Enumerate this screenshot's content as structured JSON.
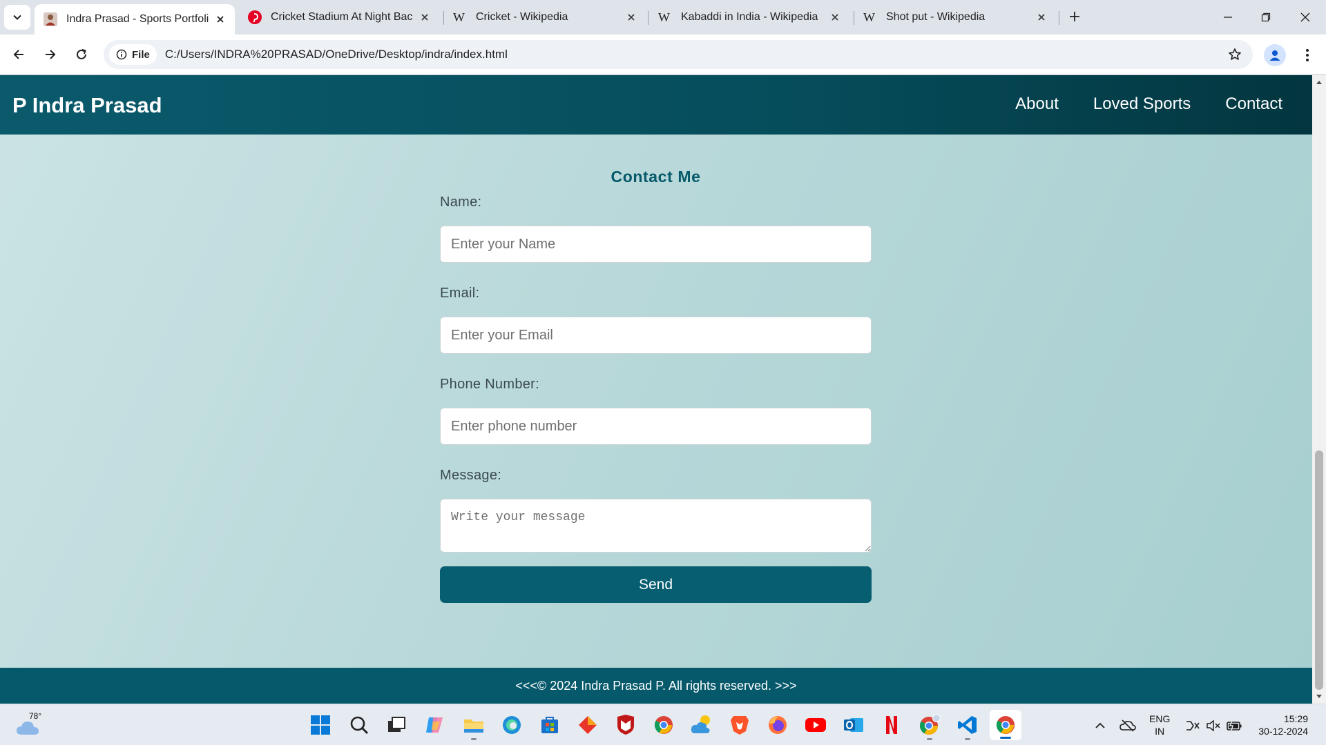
{
  "browser": {
    "tabs": [
      {
        "title": "Indra Prasad - Sports Portfolio",
        "active": true,
        "icon": "person-photo-icon"
      },
      {
        "title": "Cricket Stadium At Night Backg",
        "active": false,
        "icon": "pinterest-icon"
      },
      {
        "title": "Cricket - Wikipedia",
        "active": false,
        "icon": "wikipedia-icon"
      },
      {
        "title": "Kabaddi in India - Wikipedia",
        "active": false,
        "icon": "wikipedia-icon"
      },
      {
        "title": "Shot put - Wikipedia",
        "active": false,
        "icon": "wikipedia-icon"
      }
    ],
    "site_chip": "File",
    "url": "C:/Users/INDRA%20PRASAD/OneDrive/Desktop/indra/index.html"
  },
  "page": {
    "brand": "P Indra Prasad",
    "nav": [
      "About",
      "Loved Sports",
      "Contact"
    ],
    "contact": {
      "heading": "Contact Me",
      "name_label": "Name:",
      "name_placeholder": "Enter your Name",
      "email_label": "Email:",
      "email_placeholder": "Enter your Email",
      "phone_label": "Phone Number:",
      "phone_placeholder": "Enter phone number",
      "message_label": "Message:",
      "message_placeholder": "Write your message",
      "send_label": "Send"
    },
    "footer": "<<<© 2024 Indra Prasad P. All rights reserved. >>>",
    "colors": {
      "header": "#064d5c",
      "accent": "#05596b",
      "button": "#075e70"
    }
  },
  "taskbar": {
    "weather_temp": "78°",
    "language": [
      "ENG",
      "IN"
    ],
    "time": "15:29",
    "date": "30-12-2024"
  }
}
